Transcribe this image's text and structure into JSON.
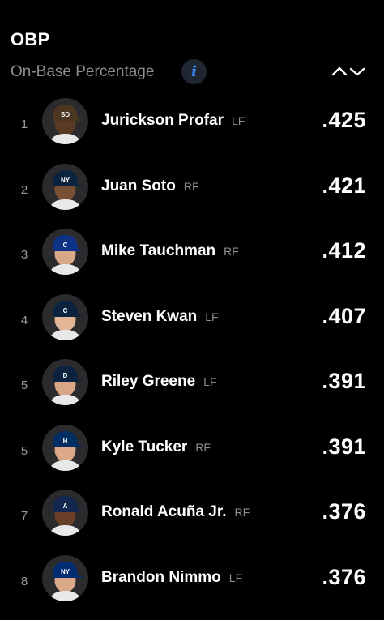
{
  "header": {
    "title": "OBP",
    "subtitle": "On-Base Percentage",
    "info_icon": "info-icon",
    "sort_icon": "sort-toggle-icon"
  },
  "leaders": [
    {
      "rank": "1",
      "name": "Jurickson Profar",
      "position": "LF",
      "value": ".425",
      "cap_color": "#4b3621",
      "cap_mark": "SD",
      "skin": "#5a3a22"
    },
    {
      "rank": "2",
      "name": "Juan Soto",
      "position": "RF",
      "value": ".421",
      "cap_color": "#0c2340",
      "cap_mark": "NY",
      "skin": "#7a5034"
    },
    {
      "rank": "3",
      "name": "Mike Tauchman",
      "position": "RF",
      "value": ".412",
      "cap_color": "#0e3386",
      "cap_mark": "C",
      "skin": "#d9a888"
    },
    {
      "rank": "4",
      "name": "Steven Kwan",
      "position": "LF",
      "value": ".407",
      "cap_color": "#0c2340",
      "cap_mark": "C",
      "skin": "#e1b596"
    },
    {
      "rank": "5",
      "name": "Riley Greene",
      "position": "LF",
      "value": ".391",
      "cap_color": "#0c2340",
      "cap_mark": "D",
      "skin": "#d8a686"
    },
    {
      "rank": "5",
      "name": "Kyle Tucker",
      "position": "RF",
      "value": ".391",
      "cap_color": "#002d62",
      "cap_mark": "H",
      "skin": "#dba98a"
    },
    {
      "rank": "7",
      "name": "Ronald Acuña Jr.",
      "position": "RF",
      "value": ".376",
      "cap_color": "#13274f",
      "cap_mark": "A",
      "skin": "#6a4128"
    },
    {
      "rank": "8",
      "name": "Brandon Nimmo",
      "position": "LF",
      "value": ".376",
      "cap_color": "#002d72",
      "cap_mark": "NY",
      "skin": "#d9a98a"
    }
  ]
}
